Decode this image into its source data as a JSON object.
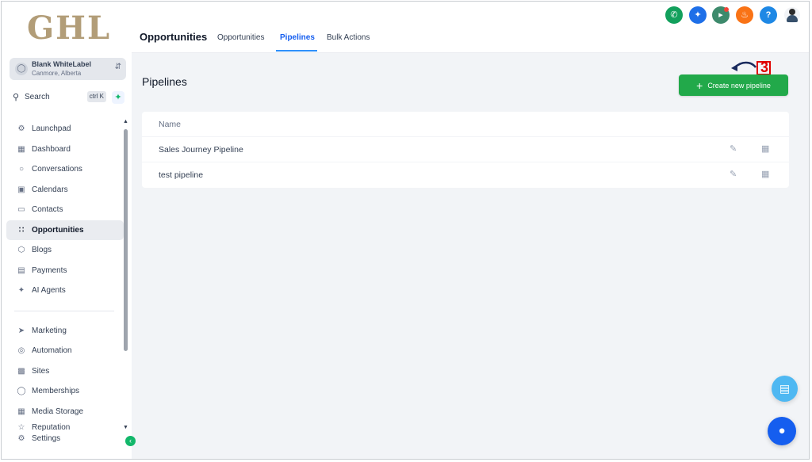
{
  "brand": {
    "logo_text": "GHL"
  },
  "account": {
    "name": "Blank WhiteLabel",
    "location": "Canmore, Alberta"
  },
  "search": {
    "label": "Search",
    "shortcut": "ctrl K"
  },
  "sidebar": {
    "items": [
      {
        "label": "Launchpad",
        "icon": "rocket-icon"
      },
      {
        "label": "Dashboard",
        "icon": "dashboard-icon"
      },
      {
        "label": "Conversations",
        "icon": "chat-bubble-icon"
      },
      {
        "label": "Calendars",
        "icon": "calendar-icon"
      },
      {
        "label": "Contacts",
        "icon": "contact-card-icon"
      },
      {
        "label": "Opportunities",
        "icon": "opportunities-icon",
        "active": true
      },
      {
        "label": "Blogs",
        "icon": "cube-icon"
      },
      {
        "label": "Payments",
        "icon": "receipt-icon"
      },
      {
        "label": "AI Agents",
        "icon": "sparkles-icon"
      }
    ],
    "items2": [
      {
        "label": "Marketing",
        "icon": "send-icon"
      },
      {
        "label": "Automation",
        "icon": "automation-icon"
      },
      {
        "label": "Sites",
        "icon": "sites-icon"
      },
      {
        "label": "Memberships",
        "icon": "badge-icon"
      },
      {
        "label": "Media Storage",
        "icon": "image-icon"
      },
      {
        "label": "Reputation",
        "icon": "star-icon"
      },
      {
        "label": "Settings",
        "icon": "gear-icon"
      }
    ]
  },
  "header": {
    "title": "Opportunities",
    "tabs": [
      {
        "label": "Opportunities"
      },
      {
        "label": "Pipelines",
        "active": true
      },
      {
        "label": "Bulk Actions"
      }
    ],
    "icons": [
      {
        "name": "phone-icon",
        "color": "#12a05c"
      },
      {
        "name": "magic-wand-icon",
        "color": "#1e6fe8"
      },
      {
        "name": "megaphone-icon",
        "color": "#3d8a6c"
      },
      {
        "name": "bell-icon",
        "color": "#f97316"
      },
      {
        "name": "help-icon",
        "color": "#1e88e5"
      }
    ]
  },
  "main": {
    "page_title": "Pipelines",
    "create_button": "Create new pipeline",
    "step_marker": "3",
    "table": {
      "header_name": "Name",
      "rows": [
        {
          "name": "Sales Journey Pipeline"
        },
        {
          "name": "test pipeline"
        }
      ]
    }
  },
  "colors": {
    "primary_green": "#22a94a",
    "accent_blue": "#155eef",
    "tab_blue": "#2e90fa"
  }
}
